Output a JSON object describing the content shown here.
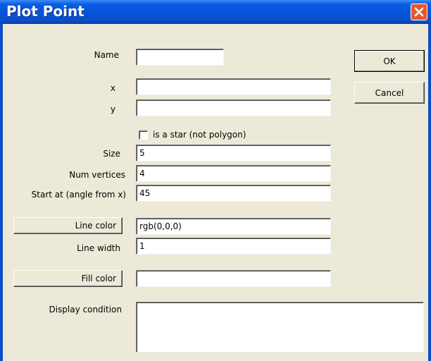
{
  "window": {
    "title": "Plot Point",
    "close_icon": "close-icon",
    "accent_color": "#0552d9",
    "close_color": "#e3592f"
  },
  "form": {
    "name_label": "Name",
    "name_value": "",
    "x_label": "x",
    "x_value": "",
    "y_label": "y",
    "y_value": "",
    "star_checkbox_label": "is a star (not polygon)",
    "star_checked": false,
    "size_label": "Size",
    "size_value": "5",
    "num_vertices_label": "Num vertices",
    "num_vertices_value": "4",
    "start_at_label": "Start at (angle from x)",
    "start_at_value": "45",
    "line_color_button": "Line color",
    "line_color_value": "rgb(0,0,0)",
    "line_width_label": "Line width",
    "line_width_value": "1",
    "fill_color_button": "Fill color",
    "fill_color_value": "",
    "display_condition_label": "Display condition",
    "display_condition_value": ""
  },
  "buttons": {
    "ok_label": "OK",
    "cancel_label": "Cancel"
  }
}
